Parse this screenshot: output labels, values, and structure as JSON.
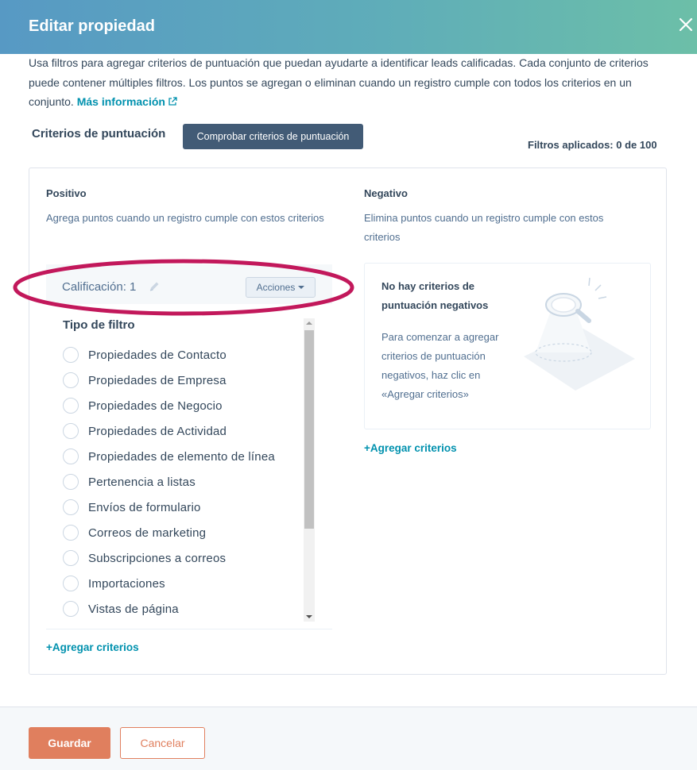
{
  "header": {
    "title": "Editar propiedad",
    "close_icon": "close-icon"
  },
  "intro": {
    "text": "Usa filtros para agregar criterios de puntuación que puedan ayudarte a identificar leads calificadas. Cada conjunto de criterios puede contener múltiples filtros. Los puntos se agregan o eliminan cuando un registro cumple con todos los criterios en un conjunto.",
    "link_label": "Más información",
    "link_icon": "external-link-icon"
  },
  "criteria": {
    "title": "Criterios de puntuación",
    "check_button": "Comprobar criterios de puntuación",
    "applied": "Filtros aplicados: 0 de 100"
  },
  "positive": {
    "title": "Positivo",
    "description": "Agrega puntos cuando un registro cumple con estos criterios",
    "score_label": "Calificación: 1",
    "edit_icon": "pencil-icon",
    "actions_button": "Acciones",
    "filter_title": "Tipo de filtro",
    "filters": [
      "Propiedades de Contacto",
      "Propiedades de Empresa",
      "Propiedades de Negocio",
      "Propiedades de Actividad",
      "Propiedades de elemento de línea",
      "Pertenencia a listas",
      "Envíos de formulario",
      "Correos de marketing",
      "Subscripciones a correos",
      "Importaciones",
      "Vistas de página"
    ],
    "add_criteria": "+Agregar criterios"
  },
  "negative": {
    "title": "Negativo",
    "description": "Elimina puntos cuando un registro cumple con estos criterios",
    "empty_title": "No hay criterios de puntuación negativos",
    "empty_desc": "Para comenzar a agregar criterios de puntuación negativos, haz clic en «Agregar criterios»",
    "illustration_icon": "magnifying-glass-spotlight-icon",
    "add_criteria": "+Agregar criterios"
  },
  "footer": {
    "save": "Guardar",
    "cancel": "Cancelar"
  },
  "colors": {
    "primary_button": "#425b76",
    "save_button": "#e07f5e",
    "link": "#0091ae",
    "highlight": "#c2185b"
  }
}
